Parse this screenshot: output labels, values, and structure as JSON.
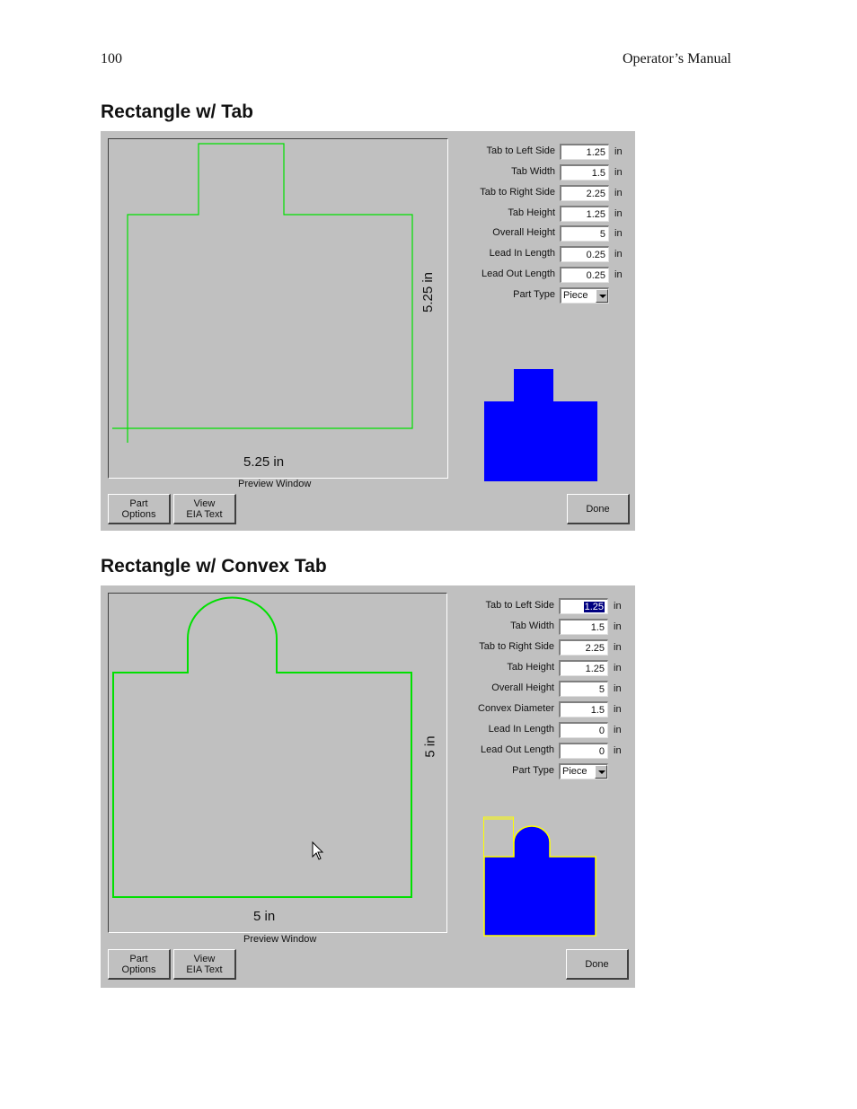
{
  "header": {
    "page_number": "100",
    "manual_title": "Operator’s Manual"
  },
  "sections": [
    {
      "heading": "Rectangle w/ Tab",
      "preview": {
        "width_label": "5.25 in",
        "height_label": "5.25 in",
        "caption": "Preview Window"
      },
      "params": [
        {
          "label": "Tab to Left Side",
          "value": "1.25",
          "unit": "in"
        },
        {
          "label": "Tab Width",
          "value": "1.5",
          "unit": "in"
        },
        {
          "label": "Tab to Right Side",
          "value": "2.25",
          "unit": "in"
        },
        {
          "label": "Tab Height",
          "value": "1.25",
          "unit": "in"
        },
        {
          "label": "Overall Height",
          "value": "5",
          "unit": "in"
        },
        {
          "label": "Lead In Length",
          "value": "0.25",
          "unit": "in"
        },
        {
          "label": "Lead Out Length",
          "value": "0.25",
          "unit": "in"
        }
      ],
      "part_type": {
        "label": "Part Type",
        "value": "Piece"
      },
      "buttons": {
        "part_options_1": "Part",
        "part_options_2": "Options",
        "view_eia_1": "View",
        "view_eia_2": "EIA Text",
        "done": "Done"
      },
      "colors": {
        "outline": "#00e000",
        "thumbnail": "#0000ff",
        "panel": "#c0c0c0"
      }
    },
    {
      "heading": "Rectangle w/ Convex Tab",
      "preview": {
        "width_label": "5 in",
        "height_label": "5 in",
        "caption": "Preview Window"
      },
      "params": [
        {
          "label": "Tab to Left Side",
          "value": "1.25",
          "unit": "in",
          "selected": true
        },
        {
          "label": "Tab Width",
          "value": "1.5",
          "unit": "in"
        },
        {
          "label": "Tab to Right Side",
          "value": "2.25",
          "unit": "in"
        },
        {
          "label": "Tab Height",
          "value": "1.25",
          "unit": "in"
        },
        {
          "label": "Overall Height",
          "value": "5",
          "unit": "in"
        },
        {
          "label": "Convex Diameter",
          "value": "1.5",
          "unit": "in"
        },
        {
          "label": "Lead In Length",
          "value": "0",
          "unit": "in"
        },
        {
          "label": "Lead Out Length",
          "value": "0",
          "unit": "in"
        }
      ],
      "part_type": {
        "label": "Part Type",
        "value": "Piece"
      },
      "buttons": {
        "part_options_1": "Part",
        "part_options_2": "Options",
        "view_eia_1": "View",
        "view_eia_2": "EIA Text",
        "done": "Done"
      },
      "colors": {
        "outline": "#00e000",
        "thumbnail": "#0000ff",
        "highlight": "#ffff00",
        "panel": "#c0c0c0"
      }
    }
  ],
  "icons": [
    "mouse-pointer-icon",
    "dropdown-arrow-icon"
  ]
}
